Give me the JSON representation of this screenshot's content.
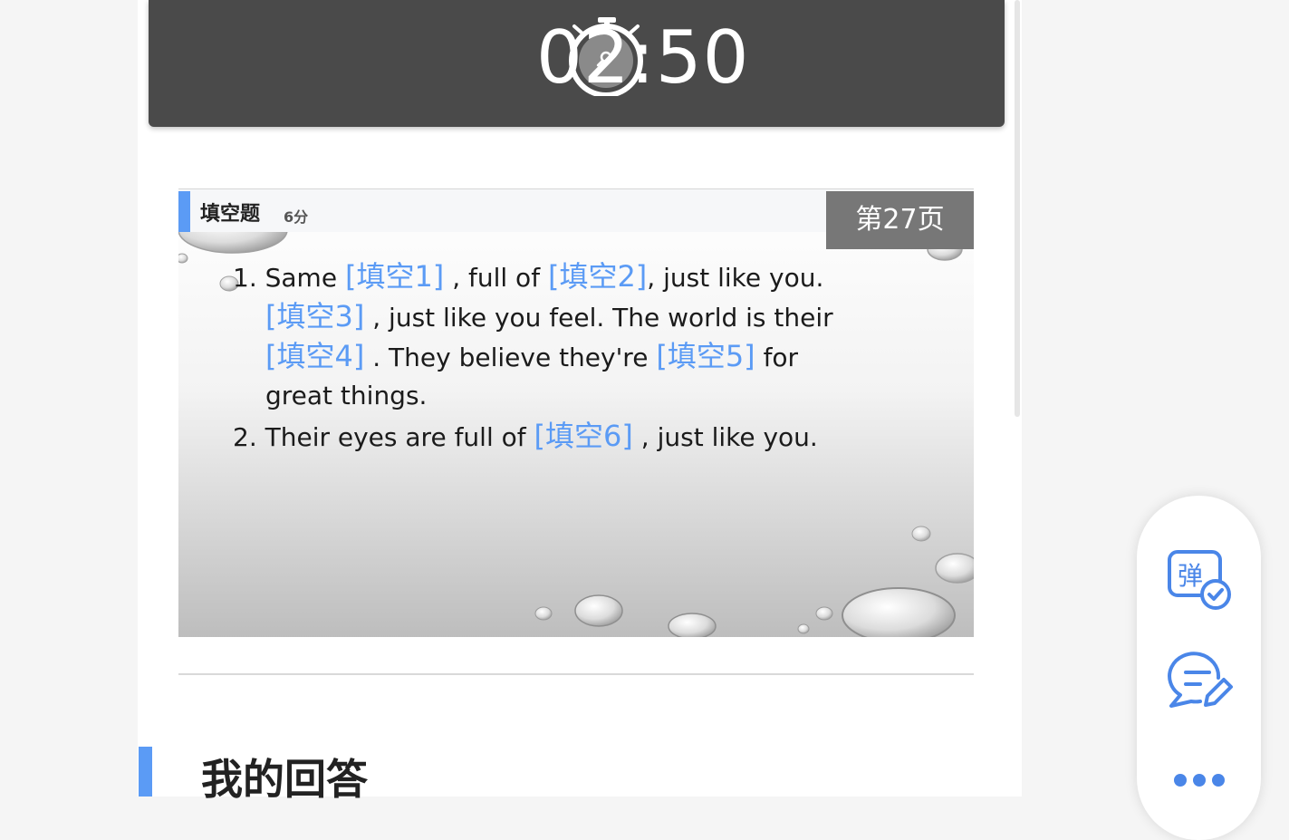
{
  "timer": {
    "remaining": "02:50",
    "icon": "stopwatch-icon"
  },
  "question": {
    "type_label": "填空题",
    "score": "6分",
    "page_label": "第27页",
    "lines": [
      {
        "pre": "1. Same ",
        "blank": "[填空1]",
        "mid": " , full of ",
        "blank2": "[填空2]",
        "post": ", just like you."
      },
      {
        "blank": "[填空3]",
        "post": " , just like you feel. The world is their"
      },
      {
        "blank": "[填空4]",
        "mid": " . They believe they're  ",
        "blank2": "[填空5]",
        "post": " for"
      },
      {
        "text": "great things."
      },
      {
        "pre": "2. Their eyes are full of  ",
        "blank": "[填空6]",
        "post": " , just like you."
      }
    ]
  },
  "answer_section": {
    "title": "我的回答"
  },
  "floating_panel": {
    "items": [
      {
        "icon": "danmaku-check-icon",
        "glyph": "弹"
      },
      {
        "icon": "chat-edit-icon"
      },
      {
        "icon": "more-icon"
      }
    ]
  },
  "colors": {
    "accent": "#5b9bf5",
    "timer_bg": "#4a4a4a",
    "page_badge_bg": "#777777"
  }
}
